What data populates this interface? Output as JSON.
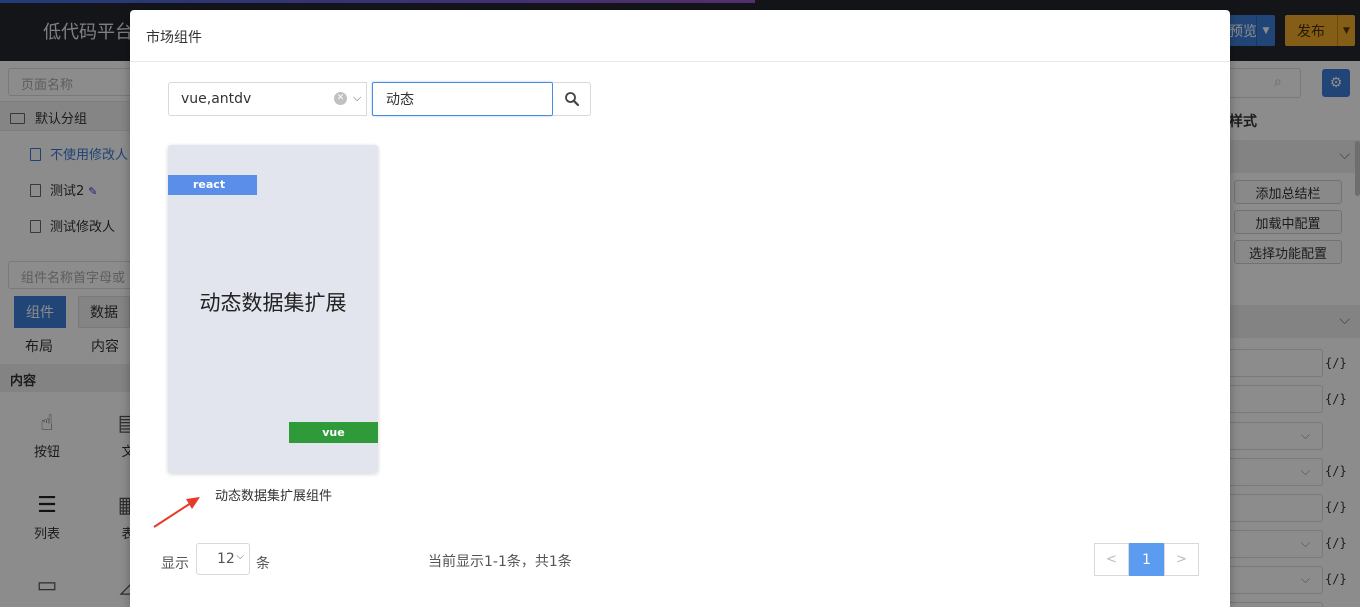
{
  "app": {
    "title": "低代码平台",
    "preview_label": "预览",
    "publish_label": "发布"
  },
  "left_panel": {
    "page_search_placeholder": "页面名称",
    "group_label": "默认分组",
    "pages": [
      "不使用修改人",
      "测试2",
      "测试修改人"
    ],
    "component_search_placeholder": "组件名称首字母或",
    "tabs": [
      "组件",
      "数据"
    ],
    "sub_tabs": [
      "布局",
      "内容"
    ],
    "section": "内容",
    "widgets": [
      "按钮",
      "文",
      "列表",
      "表"
    ]
  },
  "right_panel": {
    "style_label": "样式",
    "buttons": [
      "添加总结栏",
      "加载中配置",
      "选择功能配置"
    ],
    "code_marker": "{/}"
  },
  "modal": {
    "title": "市场组件",
    "filter_tags_value": "vue,antdv",
    "keyword_value": "动态",
    "cards": [
      {
        "top_badge": "react",
        "center_text": "动态数据集扩展",
        "bottom_badge": "vue",
        "caption": "动态数据集扩展组件"
      }
    ],
    "pagination": {
      "show_label": "显示",
      "page_size": "12",
      "unit_label": "条",
      "info": "当前显示1-1条，共1条",
      "prev": "<",
      "current_page": "1",
      "next": ">"
    }
  },
  "colors": {
    "primary": "#3d7fd8",
    "publish": "#f0a92b",
    "react_badge": "#5b8ee8",
    "vue_badge": "#2e9a3a",
    "annotation_arrow": "#e8392a"
  }
}
